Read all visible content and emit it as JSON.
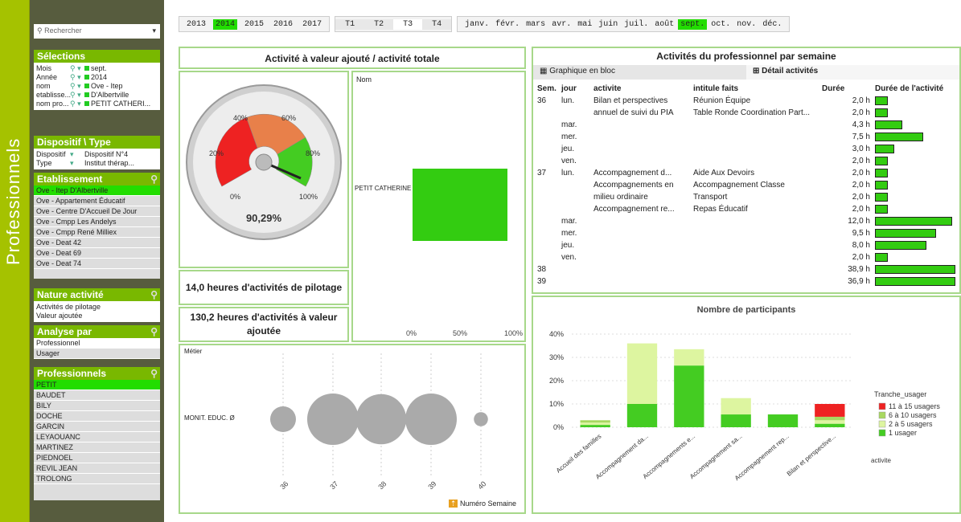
{
  "vertical_title": "Professionnels",
  "sidebar": {
    "search_placeholder": "Rechercher",
    "selections_title": "Sélections",
    "selections": [
      {
        "key": "Mois",
        "value": "sept."
      },
      {
        "key": "Année",
        "value": "2014"
      },
      {
        "key": "nom",
        "value": "Ove - Itep"
      },
      {
        "key": "etablisse...",
        "value": "D'Albertville"
      },
      {
        "key": "nom pro...",
        "value": "PETIT CATHERI..."
      }
    ],
    "dispositif_title": "Dispositif \\ Type",
    "dispositif_rows": [
      {
        "key": "Dispositif",
        "value": "Dispositif N°4"
      },
      {
        "key": "Type",
        "value": "Institut thérap..."
      }
    ],
    "etablissement_title": "Etablissement",
    "etablissements": [
      "Ove - Itep D'Albertville",
      "Ove - Appartement Éducatif",
      "Ove - Centre D'Accueil De Jour",
      "Ove - Cmpp Les Andelys",
      "Ove - Cmpp René Milliex",
      "Ove - Deat 42",
      "Ove - Deat 69",
      "Ove - Deat 74"
    ],
    "nature_title": "Nature activité",
    "natures": [
      "Activités de pilotage",
      "Valeur ajoutée"
    ],
    "analyse_title": "Analyse par",
    "analyse": [
      "Professionnel",
      "Usager"
    ],
    "professionnels_title": "Professionnels",
    "professionnels": [
      "PETIT",
      "BAUDET",
      "BILY",
      "DOCHE",
      "GARCIN",
      "LEYAOUANC",
      "MARTINEZ",
      "PIEDNOEL",
      "REVIL JEAN",
      "TROLONG"
    ]
  },
  "topbar": {
    "years": [
      "2013",
      "2014",
      "2015",
      "2016",
      "2017"
    ],
    "selected_year": "2014",
    "quarters": [
      "T1",
      "T2",
      "T3",
      "T4"
    ],
    "current_quarter": "T3",
    "months": [
      "janv.",
      "févr.",
      "mars",
      "avr.",
      "mai",
      "juin",
      "juil.",
      "août",
      "sept.",
      "oct.",
      "nov.",
      "déc."
    ],
    "selected_month": "sept."
  },
  "gauge": {
    "title": "Activité à valeur ajouté / activité totale",
    "value_label": "90,29%",
    "value": 90.29,
    "ticks": [
      "0%",
      "20%",
      "40%",
      "60%",
      "80%",
      "100%"
    ]
  },
  "kpi1": "14,0 heures d'activités de pilotage",
  "kpi2": "130,2 heures d'activités à valeur ajoutée",
  "hbar": {
    "header": "Nom",
    "label": "PETIT CATHERINE",
    "ticks": [
      "0%",
      "50%",
      "100%"
    ],
    "color": "#33cc11"
  },
  "bubble": {
    "header": "Métier",
    "row_label": "MONIT. EDUC. Ø",
    "weeks": [
      "36",
      "37",
      "38",
      "39",
      "40"
    ],
    "sizes": [
      1,
      4,
      3.8,
      4,
      0.3
    ],
    "footer": "Numéro Semaine"
  },
  "activities": {
    "title": "Activités du professionnel par semaine",
    "tab1": "Graphique en bloc",
    "tab2": "Détail activités",
    "columns": [
      "Sem.",
      "jour",
      "activite",
      "intitule faits",
      "Durée",
      "Durée de l'activité"
    ],
    "rows": [
      {
        "sem": "36",
        "jour": "lun.",
        "act": "Bilan et perspectives",
        "fait": "Réunion Équipe",
        "dur": "2,0 h",
        "v": 2.0
      },
      {
        "sem": "",
        "jour": "",
        "act": "annuel de suivi du PIA",
        "fait": "Table Ronde Coordination Part...",
        "dur": "2,0 h",
        "v": 2.0
      },
      {
        "sem": "",
        "jour": "mar.",
        "act": "",
        "fait": "",
        "dur": "4,3 h",
        "v": 4.3
      },
      {
        "sem": "",
        "jour": "mer.",
        "act": "",
        "fait": "",
        "dur": "7,5 h",
        "v": 7.5
      },
      {
        "sem": "",
        "jour": "jeu.",
        "act": "",
        "fait": "",
        "dur": "3,0 h",
        "v": 3.0
      },
      {
        "sem": "",
        "jour": "ven.",
        "act": "",
        "fait": "",
        "dur": "2,0 h",
        "v": 2.0
      },
      {
        "sem": "37",
        "jour": "lun.",
        "act": "Accompagnement d...",
        "fait": "Aide Aux Devoirs",
        "dur": "2,0 h",
        "v": 2.0
      },
      {
        "sem": "",
        "jour": "",
        "act": "Accompagnements en",
        "fait": "Accompagnement Classe",
        "dur": "2,0 h",
        "v": 2.0
      },
      {
        "sem": "",
        "jour": "",
        "act": "milieu ordinaire",
        "fait": "Transport",
        "dur": "2,0 h",
        "v": 2.0
      },
      {
        "sem": "",
        "jour": "",
        "act": "Accompagnement re...",
        "fait": "Repas Éducatif",
        "dur": "2,0 h",
        "v": 2.0
      },
      {
        "sem": "",
        "jour": "mar.",
        "act": "",
        "fait": "",
        "dur": "12,0 h",
        "v": 12.0
      },
      {
        "sem": "",
        "jour": "mer.",
        "act": "",
        "fait": "",
        "dur": "9,5 h",
        "v": 9.5
      },
      {
        "sem": "",
        "jour": "jeu.",
        "act": "",
        "fait": "",
        "dur": "8,0 h",
        "v": 8.0
      },
      {
        "sem": "",
        "jour": "ven.",
        "act": "",
        "fait": "",
        "dur": "2,0 h",
        "v": 2.0
      },
      {
        "sem": "38",
        "jour": "",
        "act": "",
        "fait": "",
        "dur": "38,9 h",
        "v": 38.9
      },
      {
        "sem": "39",
        "jour": "",
        "act": "",
        "fait": "",
        "dur": "36,9 h",
        "v": 36.9
      }
    ]
  },
  "chart_data": {
    "type": "bar",
    "title": "Nombre de participants",
    "categories": [
      "Accueil des familles",
      "Accompagnement da...",
      "Accompagnements e...",
      "Accompagnement sa...",
      "Accompagnement rep...",
      "Bilan et perspective..."
    ],
    "series": [
      {
        "name": "1 usager",
        "color": "#44cc22",
        "values": [
          1,
          10,
          26.5,
          5.5,
          5.5,
          1.5
        ]
      },
      {
        "name": "2 à 5 usagers",
        "color": "#ddf5a0",
        "values": [
          1,
          26,
          7,
          7,
          0,
          1.5
        ]
      },
      {
        "name": "6 à 10 usagers",
        "color": "#a8d860",
        "values": [
          1,
          0,
          0,
          0,
          0,
          1.5
        ]
      },
      {
        "name": "11 à 15 usagers",
        "color": "#ee2222",
        "values": [
          0,
          0,
          0,
          0,
          0,
          5.5
        ]
      }
    ],
    "yticks": [
      "0%",
      "10%",
      "20%",
      "30%",
      "40%"
    ],
    "ylim": [
      0,
      40
    ],
    "legend_title": "Tranche_usager",
    "xlabel": "activite"
  }
}
